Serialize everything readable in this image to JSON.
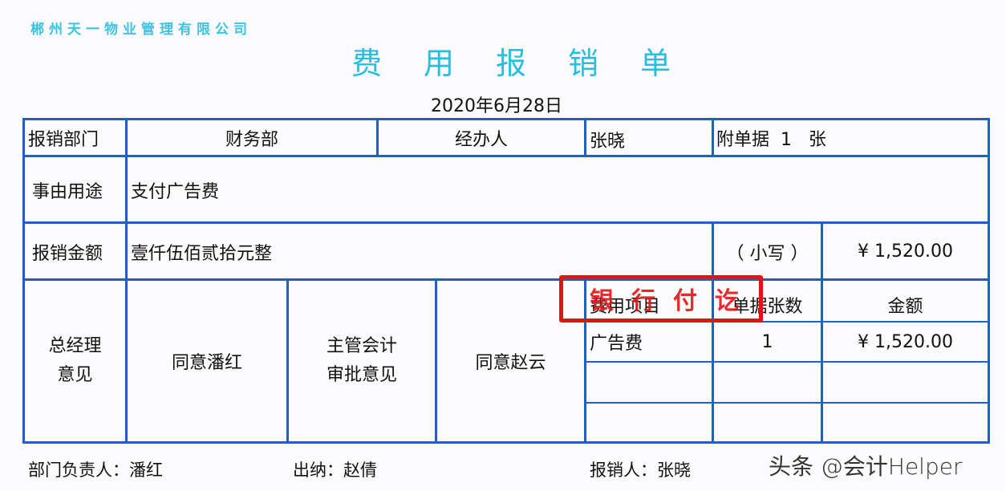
{
  "company_name": "郴州天一物业管理有限公司",
  "form_title": "费用报销单",
  "date": "2020年6月28日",
  "row1": {
    "dept_label": "报销部门",
    "dept_value": "财务部",
    "handler_label": "经办人",
    "handler_value": "张晓",
    "attachments": "附单据  1   张"
  },
  "row2": {
    "purpose_label": "事由用途",
    "purpose_value": "支付广告费"
  },
  "row3": {
    "amount_label": "报销金额",
    "amount_words": "壹仟伍佰贰拾元整",
    "lowercase_label": "（ 小写 ）",
    "amount_figure": "¥ 1,520.00"
  },
  "approval": {
    "gm_label_line1": "总经理",
    "gm_label_line2": "意见",
    "gm_opinion": "同意潘红",
    "chief_accountant_label_line1": "主管会计",
    "chief_accountant_label_line2": "审批意见",
    "chief_accountant_opinion": "同意赵云"
  },
  "items_table": {
    "headers": [
      "费用项目",
      "单据张数",
      "金额"
    ],
    "rows": [
      [
        "广告费",
        "1",
        "¥ 1,520.00"
      ],
      [
        "",
        "",
        ""
      ],
      [
        "",
        "",
        ""
      ]
    ]
  },
  "stamp": {
    "text": "银行付讫",
    "color": "#e31313"
  },
  "footer": {
    "dept_head": "部门负责人：潘红",
    "cashier": "出纳：赵倩",
    "claimant": "报销人：张晓"
  },
  "watermark": "头条 @会计Helper",
  "colors": {
    "grid": "#1f5fc6",
    "title": "#29bde0",
    "company": "#3bc4e4"
  }
}
